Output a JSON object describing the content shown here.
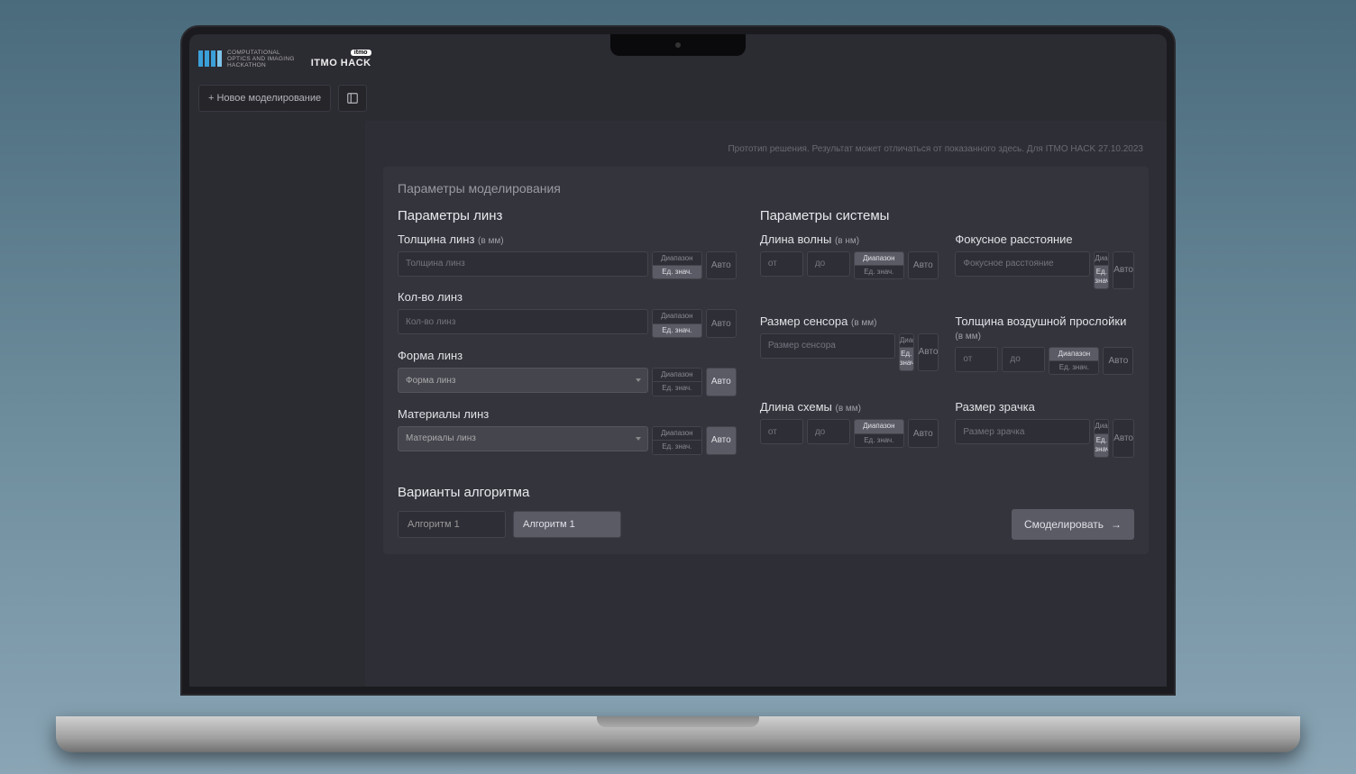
{
  "logo": {
    "line1": "COMPUTATIONAL",
    "line2": "OPTICS AND IMAGING",
    "line3": "HACKATHON",
    "tag": "itmo",
    "brand": "ITMO HACK"
  },
  "toolbar": {
    "new_label": "+ Новое моделирование"
  },
  "proto_bar": "Прототип решения. Результат может отличаться от показанного здесь. Для ITMO HACK 27.10.2023",
  "panel": {
    "title": "Параметры моделирования",
    "lens": {
      "title": "Параметры линз",
      "thickness": {
        "label": "Толщина линз",
        "unit": "(в мм)",
        "placeholder": "Толщина линз"
      },
      "count": {
        "label": "Кол-во линз",
        "placeholder": "Кол-во линз"
      },
      "shape": {
        "label": "Форма линз",
        "placeholder": "Форма линз"
      },
      "materials": {
        "label": "Материалы линз",
        "placeholder": "Материалы линз"
      }
    },
    "system": {
      "title": "Параметры системы",
      "wavelength": {
        "label": "Длина волны",
        "unit": "(в нм)",
        "from": "от",
        "to": "до"
      },
      "focal": {
        "label": "Фокусное расстояние",
        "placeholder": "Фокусное расстояние"
      },
      "sensor": {
        "label": "Размер сенсора",
        "unit": "(в мм)",
        "placeholder": "Размер сенсора"
      },
      "air": {
        "label": "Толщина воздушной прослойки",
        "unit": "(в мм)",
        "from": "от",
        "to": "до"
      },
      "scheme": {
        "label": "Длина схемы",
        "unit": "(в мм)",
        "from": "от",
        "to": "до"
      },
      "pupil": {
        "label": "Размер зрачка",
        "placeholder": "Размер зрачка"
      }
    },
    "toggle": {
      "range": "Диапазон",
      "single": "Ед. знач."
    },
    "auto": "Авто",
    "algo": {
      "title": "Варианты алгоритма",
      "opt1": "Алгоритм 1",
      "opt2": "Алгоритм 1"
    },
    "submit": "Смоделировать"
  }
}
